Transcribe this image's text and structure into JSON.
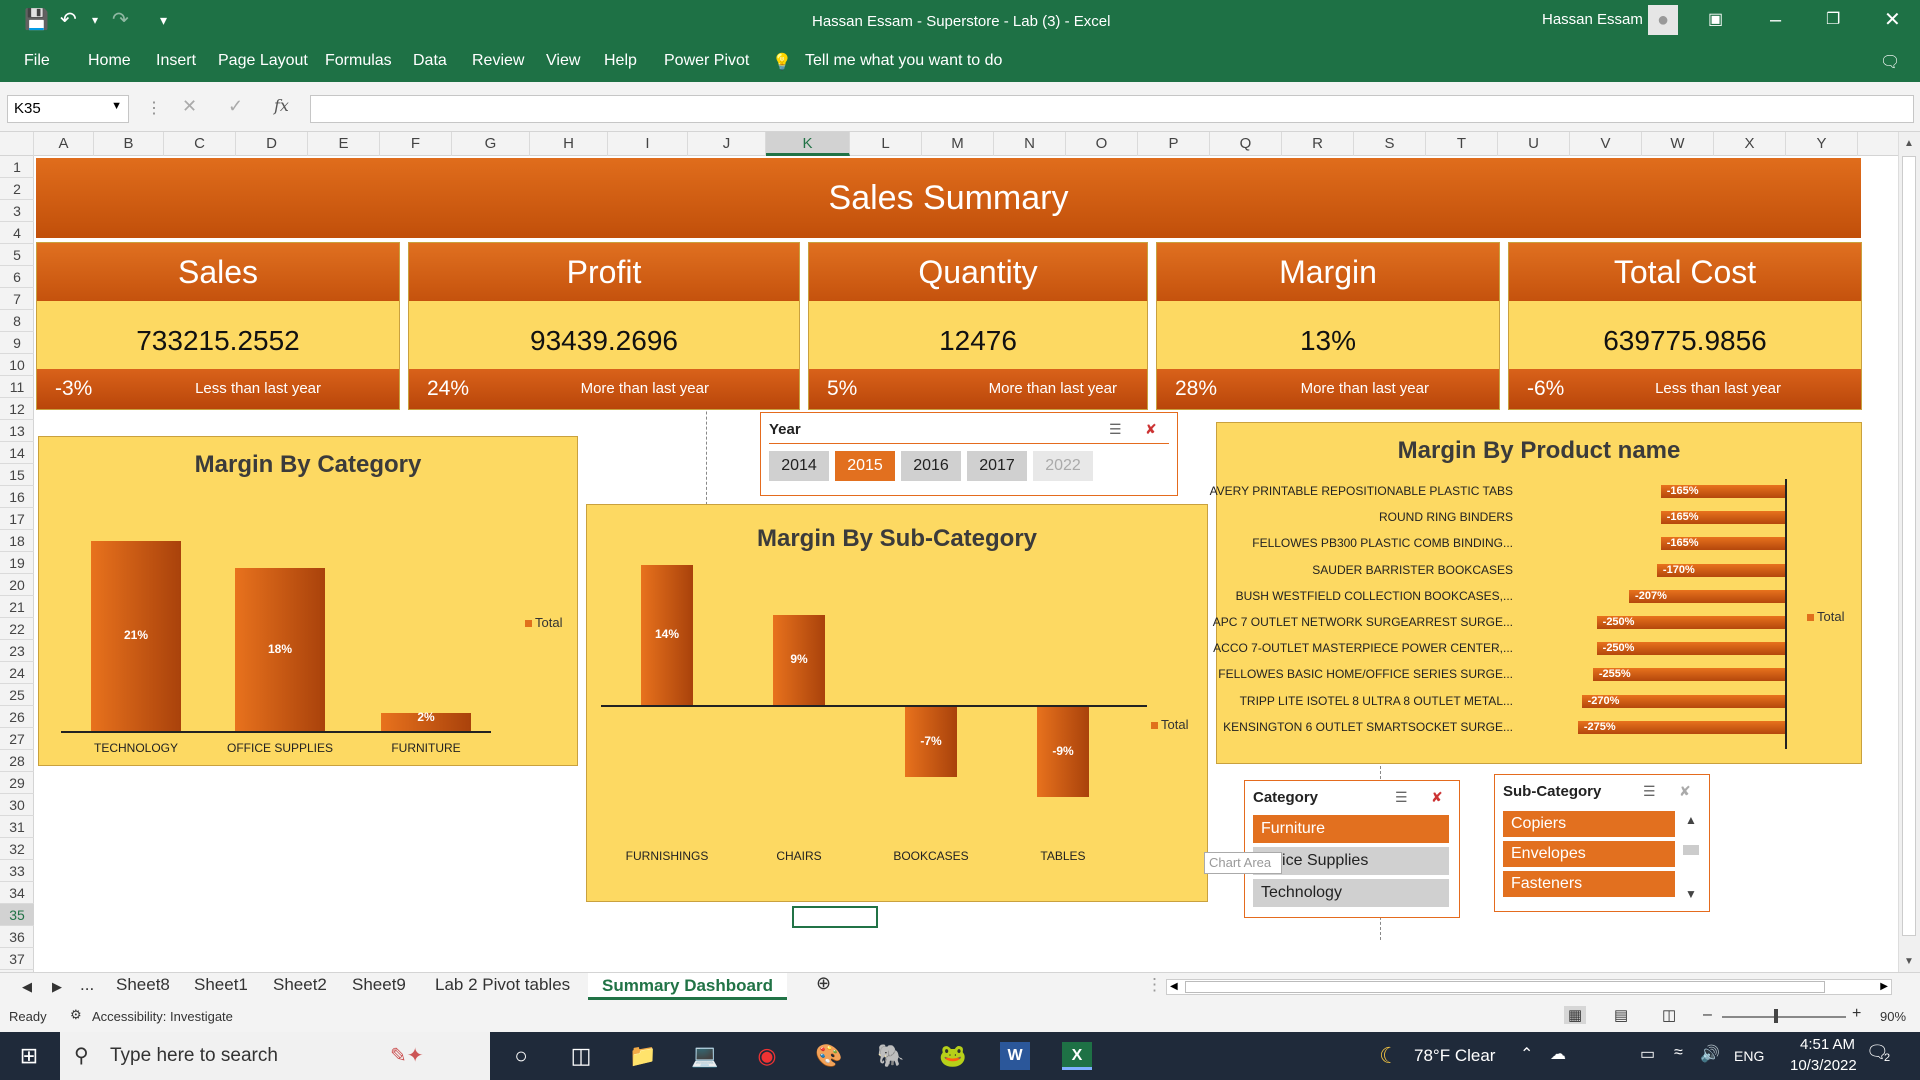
{
  "window": {
    "title": "Hassan Essam - Superstore - Lab (3)  -  Excel",
    "user": "Hassan Essam"
  },
  "ribbon": {
    "tabs": [
      "File",
      "Home",
      "Insert",
      "Page Layout",
      "Formulas",
      "Data",
      "Review",
      "View",
      "Help",
      "Power Pivot"
    ],
    "tell_me": "Tell me what you want to do"
  },
  "formula_bar": {
    "name_box": "K35",
    "fx": "fx",
    "value": ""
  },
  "columns": [
    "A",
    "B",
    "C",
    "D",
    "E",
    "F",
    "G",
    "H",
    "I",
    "J",
    "K",
    "L",
    "M",
    "N",
    "O",
    "P",
    "Q",
    "R",
    "S",
    "T",
    "U",
    "V",
    "W",
    "X",
    "Y"
  ],
  "selected_column": "K",
  "rows": [
    "1",
    "2",
    "3",
    "4",
    "5",
    "6",
    "7",
    "8",
    "9",
    "10",
    "11",
    "12",
    "13",
    "14",
    "15",
    "16",
    "17",
    "18",
    "19",
    "20",
    "21",
    "22",
    "23",
    "24",
    "25",
    "26",
    "27",
    "28",
    "29",
    "30",
    "31",
    "32",
    "33",
    "34",
    "35",
    "36",
    "37"
  ],
  "selected_row": "35",
  "dashboard": {
    "title": "Sales Summary",
    "kpis": [
      {
        "name": "Sales",
        "value": "733215.2552",
        "change": "-3%",
        "note": "Less than last year"
      },
      {
        "name": "Profit",
        "value": "93439.2696",
        "change": "24%",
        "note": "More than last year"
      },
      {
        "name": "Quantity",
        "value": "12476",
        "change": "5%",
        "note": "More than last year"
      },
      {
        "name": "Margin",
        "value": "13%",
        "change": "28%",
        "note": "More than last year"
      },
      {
        "name": "Total Cost",
        "value": "639775.9856",
        "change": "-6%",
        "note": "Less than last year"
      }
    ]
  },
  "chart_data": [
    {
      "type": "bar",
      "title": "Margin By Category",
      "categories": [
        "TECHNOLOGY",
        "OFFICE SUPPLIES",
        "FURNITURE"
      ],
      "series": [
        {
          "name": "Total",
          "values": [
            21,
            18,
            2
          ]
        }
      ],
      "data_labels": [
        "21%",
        "18%",
        "2%"
      ],
      "legend": "right"
    },
    {
      "type": "bar",
      "title": "Margin By Sub-Category",
      "categories": [
        "FURNISHINGS",
        "CHAIRS",
        "BOOKCASES",
        "TABLES"
      ],
      "series": [
        {
          "name": "Total",
          "values": [
            14,
            9,
            -7,
            -9
          ]
        }
      ],
      "data_labels": [
        "14%",
        "9%",
        "-7%",
        "-9%"
      ],
      "legend": "right"
    },
    {
      "type": "bar",
      "orientation": "horizontal",
      "title": "Margin By Product name",
      "categories": [
        "AVERY PRINTABLE REPOSITIONABLE PLASTIC TABS",
        "ROUND RING BINDERS",
        "FELLOWES PB300 PLASTIC COMB BINDING...",
        "SAUDER BARRISTER BOOKCASES",
        "BUSH WESTFIELD COLLECTION BOOKCASES,...",
        "APC 7 OUTLET NETWORK SURGEARREST SURGE...",
        "ACCO 7-OUTLET MASTERPIECE POWER CENTER,...",
        "FELLOWES BASIC HOME/OFFICE SERIES SURGE...",
        "TRIPP LITE ISOTEL 8 ULTRA 8 OUTLET METAL...",
        "KENSINGTON 6 OUTLET SMARTSOCKET SURGE..."
      ],
      "series": [
        {
          "name": "Total",
          "values": [
            -165,
            -165,
            -165,
            -170,
            -207,
            -250,
            -250,
            -255,
            -270,
            -275
          ]
        }
      ],
      "data_labels": [
        "-165%",
        "-165%",
        "-165%",
        "-170%",
        "-207%",
        "-250%",
        "-250%",
        "-255%",
        "-270%",
        "-275%"
      ],
      "legend": "right"
    }
  ],
  "slicers": {
    "year": {
      "title": "Year",
      "items": [
        "2014",
        "2015",
        "2016",
        "2017",
        "2022"
      ],
      "selected": "2015"
    },
    "category": {
      "title": "Category",
      "items": [
        "Furniture",
        "Office Supplies",
        "Technology"
      ],
      "selected": "Furniture"
    },
    "subcategory": {
      "title": "Sub-Category",
      "items": [
        "Copiers",
        "Envelopes",
        "Fasteners"
      ]
    }
  },
  "tooltip": "Chart Area",
  "sheet_tabs": [
    "Sheet8",
    "Sheet1",
    "Sheet2",
    "Sheet9",
    "Lab 2 Pivot tables",
    "Summary Dashboard"
  ],
  "active_sheet": "Summary Dashboard",
  "status": {
    "ready": "Ready",
    "accessibility": "Accessibility: Investigate",
    "zoom": "90%"
  },
  "taskbar": {
    "search_placeholder": "Type here to search",
    "weather": "78°F  Clear",
    "language": "ENG",
    "time": "4:51 AM",
    "date": "10/3/2022",
    "notifications": "2"
  },
  "colors": {
    "excel_green": "#1e7145",
    "orange": "#e2701f",
    "panel_yellow": "#fdd962"
  }
}
